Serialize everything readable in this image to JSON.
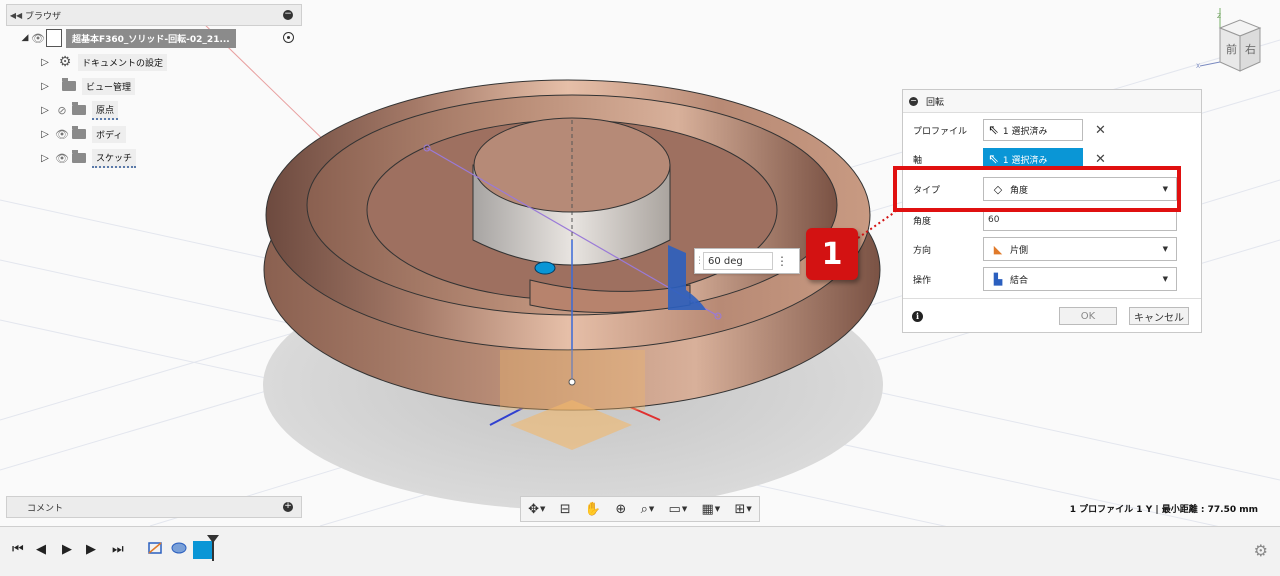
{
  "browser": {
    "title": "ブラウザ",
    "root": "超基本F360_ソリッド-回転-02_21...",
    "items": [
      {
        "label": "ドキュメントの設定",
        "icon": "gear-icon"
      },
      {
        "label": "ビュー管理",
        "icon": "folder-icon"
      },
      {
        "label": "原点",
        "icon": "folder-icon"
      },
      {
        "label": "ボディ",
        "icon": "folder-icon"
      },
      {
        "label": "スケッチ",
        "icon": "folder-icon"
      }
    ]
  },
  "comments": {
    "title": "コメント"
  },
  "viewcube": {
    "front": "前",
    "right": "右",
    "z": "Z",
    "x": "X"
  },
  "dimension": {
    "value": "60 deg"
  },
  "callout": {
    "number": "1"
  },
  "dialog": {
    "title": "回転",
    "profile_label": "プロファイル",
    "profile_value": "1 選択済み",
    "axis_label": "軸",
    "axis_value": "1 選択済み",
    "type_label": "タイプ",
    "type_value": "角度",
    "angle_label": "角度",
    "angle_value": "60",
    "direction_label": "方向",
    "direction_value": "片側",
    "operation_label": "操作",
    "operation_value": "結合",
    "ok": "OK",
    "cancel": "キャンセル"
  },
  "status": {
    "text": "1 プロファイル 1 Y | 最小距離 : 77.50 mm"
  },
  "colors": {
    "accent": "#0a96d6",
    "highlight": "#e01010",
    "callout": "#d31212",
    "body": "#c79a84"
  }
}
